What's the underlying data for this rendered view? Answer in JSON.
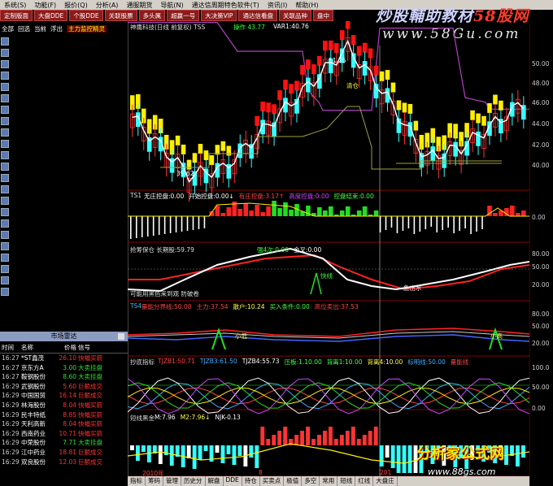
{
  "menu": [
    "系统(S)",
    "功能(F)",
    "报价(Q)",
    "分析(A)",
    "通服期货",
    "导航(N)",
    "通达信周期特色软件(T)",
    "资讯(I)",
    "帮助(H)"
  ],
  "tabs": [
    "定制版面",
    "大盘DDE",
    "个股DDE",
    "关联股票",
    "多头属",
    "超赢一号",
    "大决策VIP",
    "通达信看盘",
    "关联品种",
    "盘中"
  ],
  "watermark": {
    "brand1": "炒股輔助教材",
    "brand2": "58股网",
    "site": "www.58Gu.com"
  },
  "left": {
    "links": [
      "全部",
      "回选",
      "当前",
      "浮出"
    ],
    "highlight": "主力监控精灵",
    "radar_title": "市场雷达",
    "radar_headers": [
      "时间",
      "名称",
      "价格",
      "信号"
    ],
    "radar_rows": [
      {
        "time": "16:27",
        "name": "*ST鑫茂",
        "price": "26.10",
        "signal": "快幅买箭",
        "color": "#ff3333"
      },
      {
        "time": "16:27",
        "name": "京东方A",
        "price": "3.00",
        "signal": "大卖挂盘",
        "color": "#33dd33"
      },
      {
        "time": "16:27",
        "name": "鞍钢股份",
        "price": "8.60",
        "signal": "大卖挂盘",
        "color": "#33dd33"
      },
      {
        "time": "16:29",
        "name": "武钢股份",
        "price": "5.60",
        "signal": "巨额成交",
        "color": "#ff3333"
      },
      {
        "time": "16:29",
        "name": "中国国贸",
        "price": "16.14",
        "signal": "巨额成交",
        "color": "#ff3333"
      },
      {
        "time": "16:29",
        "name": "林海股份",
        "price": "8.04",
        "signal": "快幅买箭",
        "color": "#ff3333"
      },
      {
        "time": "16:29",
        "name": "民丰特纸",
        "price": "8.85",
        "signal": "快幅买箭",
        "color": "#ff3333"
      },
      {
        "time": "16:29",
        "name": "天利高新",
        "price": "8.04",
        "signal": "快幅买箭",
        "color": "#ff3333"
      },
      {
        "time": "16:29",
        "name": "西南药业",
        "price": "10.71",
        "signal": "快幅买箭",
        "color": "#ff3333"
      },
      {
        "time": "16:29",
        "name": "中荣股份",
        "price": "7.71",
        "signal": "大卖挂盘",
        "color": "#33dd33"
      },
      {
        "time": "16:29",
        "name": "江中药业",
        "price": "18.81",
        "signal": "巨额成交",
        "color": "#ff3333"
      },
      {
        "time": "16:29",
        "name": "双良股份",
        "price": "12.03",
        "signal": "巨额成交",
        "color": "#ff3333"
      }
    ]
  },
  "main_chart": {
    "title": "神鹰科技(日线 前复权) TSS",
    "label_caozuo": "操作 43.77",
    "label_var": "VAR1:40.76",
    "high_label": "51.25",
    "low_label": "39.62",
    "note_buy": "清仓",
    "y_ticks": [
      "50.00",
      "48.00",
      "46.00",
      "44.00",
      "42.00",
      "40.00"
    ]
  },
  "panel1": {
    "title": "TS1",
    "items": [
      {
        "text": "无庄控盘:0.00",
        "color": "#ffffff"
      },
      {
        "text": "开始控盘:0.00↓",
        "color": "#ffffff"
      },
      {
        "text": "有庄控盘:3.17↑",
        "color": "#ff4444"
      },
      {
        "text": "高度控盘:0.00",
        "color": "#cc44ff"
      },
      {
        "text": "控盘结束:0.00",
        "color": "#44ff44"
      }
    ],
    "y_ticks": [
      "0.00"
    ]
  },
  "panel2": {
    "title": "抢筹保仓 长期股:59.79",
    "items": [
      {
        "text": "强4次:0.00",
        "color": "#44ff44"
      },
      {
        "text": "金叉:0.00",
        "color": "#ffffff"
      }
    ],
    "note_fast": "快线",
    "note_bottom": "可能用黑色来到观  防破卷",
    "note_fish": "鱼出水",
    "y_ticks": [
      "80.00",
      "50.00",
      "20.00"
    ]
  },
  "panel3": {
    "title": "TS4",
    "items": [
      {
        "text": "量能分界线:50.00",
        "color": "#ff4444"
      },
      {
        "text": "主力:37.54",
        "color": "#ff4444"
      },
      {
        "text": "散户:10.24",
        "color": "#ffff44"
      },
      {
        "text": "买入条件:0.00",
        "color": "#44ff44"
      },
      {
        "text": "高位卖出:37.53",
        "color": "#ff4444"
      }
    ],
    "note_low": "小低",
    "note_high": "小高",
    "y_ticks": [
      "80.00",
      "50.00",
      "20.00"
    ]
  },
  "panel4": {
    "title": "抄底指标",
    "items": [
      {
        "text": "TJZB1:50.71",
        "color": "#ff4444"
      },
      {
        "text": "TJZB3:61.50",
        "color": "#44aaff"
      },
      {
        "text": "TJZB4:55.73",
        "color": "#ffffff"
      },
      {
        "text": "压板:1.10.00",
        "color": "#44ff44"
      },
      {
        "text": "背离1:10.00",
        "color": "#44ff44"
      },
      {
        "text": "背离4:10.00",
        "color": "#ffff44"
      },
      {
        "text": "标明线:50.00",
        "color": "#44aaff"
      },
      {
        "text": "量能线",
        "color": "#ff4444"
      }
    ],
    "y_ticks": [
      "100.0",
      "50.00",
      "0.00"
    ]
  },
  "panel5": {
    "title": "短线黑金",
    "items": [
      {
        "text": "M:7.96",
        "color": "#ffffff"
      },
      {
        "text": "M2:7.96↓",
        "color": "#ffff44"
      },
      {
        "text": "NJK-0.13",
        "color": "#ffffff"
      }
    ]
  },
  "bottom_tabs": [
    "指标",
    "筹码",
    "管理",
    "历史分",
    "解盘",
    "DDE",
    "持仓",
    "买卖点",
    "极值",
    "多空",
    "常用",
    "短线",
    "红线",
    "大盘庄"
  ],
  "year_label": "2010年",
  "month_label": "8",
  "date_label": "201",
  "logo": {
    "title": "分析家公式网",
    "url": "www.88gs.com"
  }
}
